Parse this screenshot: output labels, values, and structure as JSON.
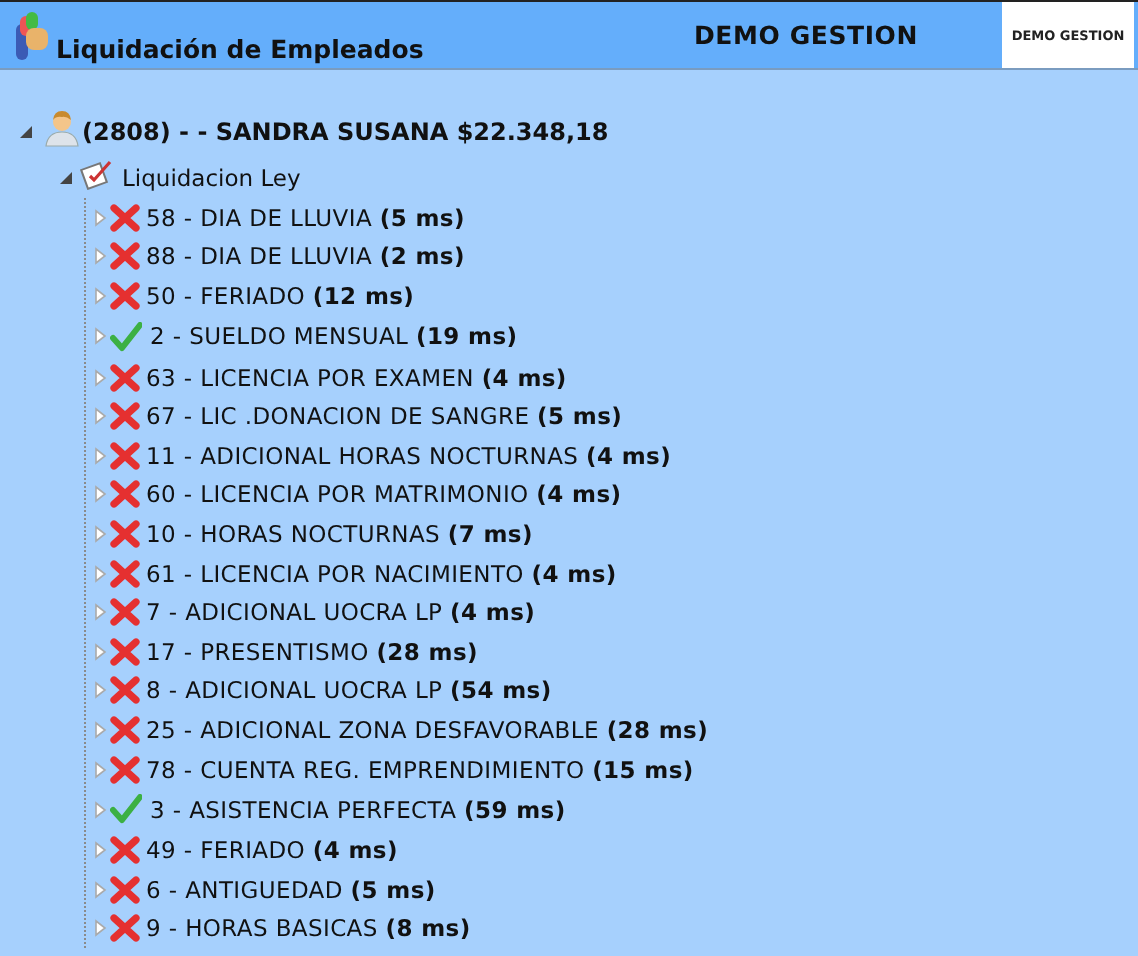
{
  "header": {
    "title": "Liquidación de Empleados",
    "company": "DEMO GESTION",
    "logo_text": "DEMO GESTION"
  },
  "tree": [
    {
      "label": "(2808) - - SANDRA SUSANA $22.348,18",
      "kind": "employee",
      "expanded": true,
      "children": [
        {
          "label": "Liquidacion Ley",
          "kind": "group",
          "expanded": true,
          "children": [
            {
              "label": "58 - DIA DE LLUVIA",
              "time": "(5 ms)",
              "passed": false,
              "expanded": false
            },
            {
              "label": "88 - DIA DE LLUVIA",
              "time": "(2 ms)",
              "passed": false,
              "expanded": false
            },
            {
              "label": "50 - FERIADO",
              "time": "(12 ms)",
              "passed": false,
              "expanded": false
            },
            {
              "label": "2 - SUELDO MENSUAL",
              "time": "(19 ms)",
              "passed": true,
              "expanded": false
            },
            {
              "label": "63 - LICENCIA POR EXAMEN",
              "time": "(4 ms)",
              "passed": false,
              "expanded": false
            },
            {
              "label": "67 - LIC .DONACION DE SANGRE",
              "time": "(5 ms)",
              "passed": false,
              "expanded": false
            },
            {
              "label": "11 - ADICIONAL HORAS NOCTURNAS",
              "time": "(4 ms)",
              "passed": false,
              "expanded": false
            },
            {
              "label": "60 - LICENCIA POR MATRIMONIO",
              "time": "(4 ms)",
              "passed": false,
              "expanded": false
            },
            {
              "label": "10 - HORAS NOCTURNAS",
              "time": "(7 ms)",
              "passed": false,
              "expanded": false
            },
            {
              "label": "61 - LICENCIA POR NACIMIENTO",
              "time": "(4 ms)",
              "passed": false,
              "expanded": false
            },
            {
              "label": "7 - ADICIONAL UOCRA LP",
              "time": "(4 ms)",
              "passed": false,
              "expanded": false
            },
            {
              "label": "17 - PRESENTISMO",
              "time": "(28 ms)",
              "passed": false,
              "expanded": false
            },
            {
              "label": "8 - ADICIONAL UOCRA LP",
              "time": "(54 ms)",
              "passed": false,
              "expanded": false
            },
            {
              "label": "25 - ADICIONAL ZONA DESFAVORABLE",
              "time": "(28 ms)",
              "passed": false,
              "expanded": false
            },
            {
              "label": "78 - CUENTA REG. EMPRENDIMIENTO",
              "time": "(15 ms)",
              "passed": false,
              "expanded": false
            },
            {
              "label": "3 - ASISTENCIA PERFECTA",
              "time": "(59 ms)",
              "passed": true,
              "expanded": false
            },
            {
              "label": "49 - FERIADO",
              "time": "(4 ms)",
              "passed": false,
              "expanded": false
            },
            {
              "label": "6 - ANTIGUEDAD",
              "time": "(5 ms)",
              "passed": false,
              "expanded": false
            },
            {
              "label": "9 - HORAS BASICAS",
              "time": "(8 ms)",
              "passed": false,
              "expanded": false
            }
          ]
        }
      ]
    }
  ]
}
